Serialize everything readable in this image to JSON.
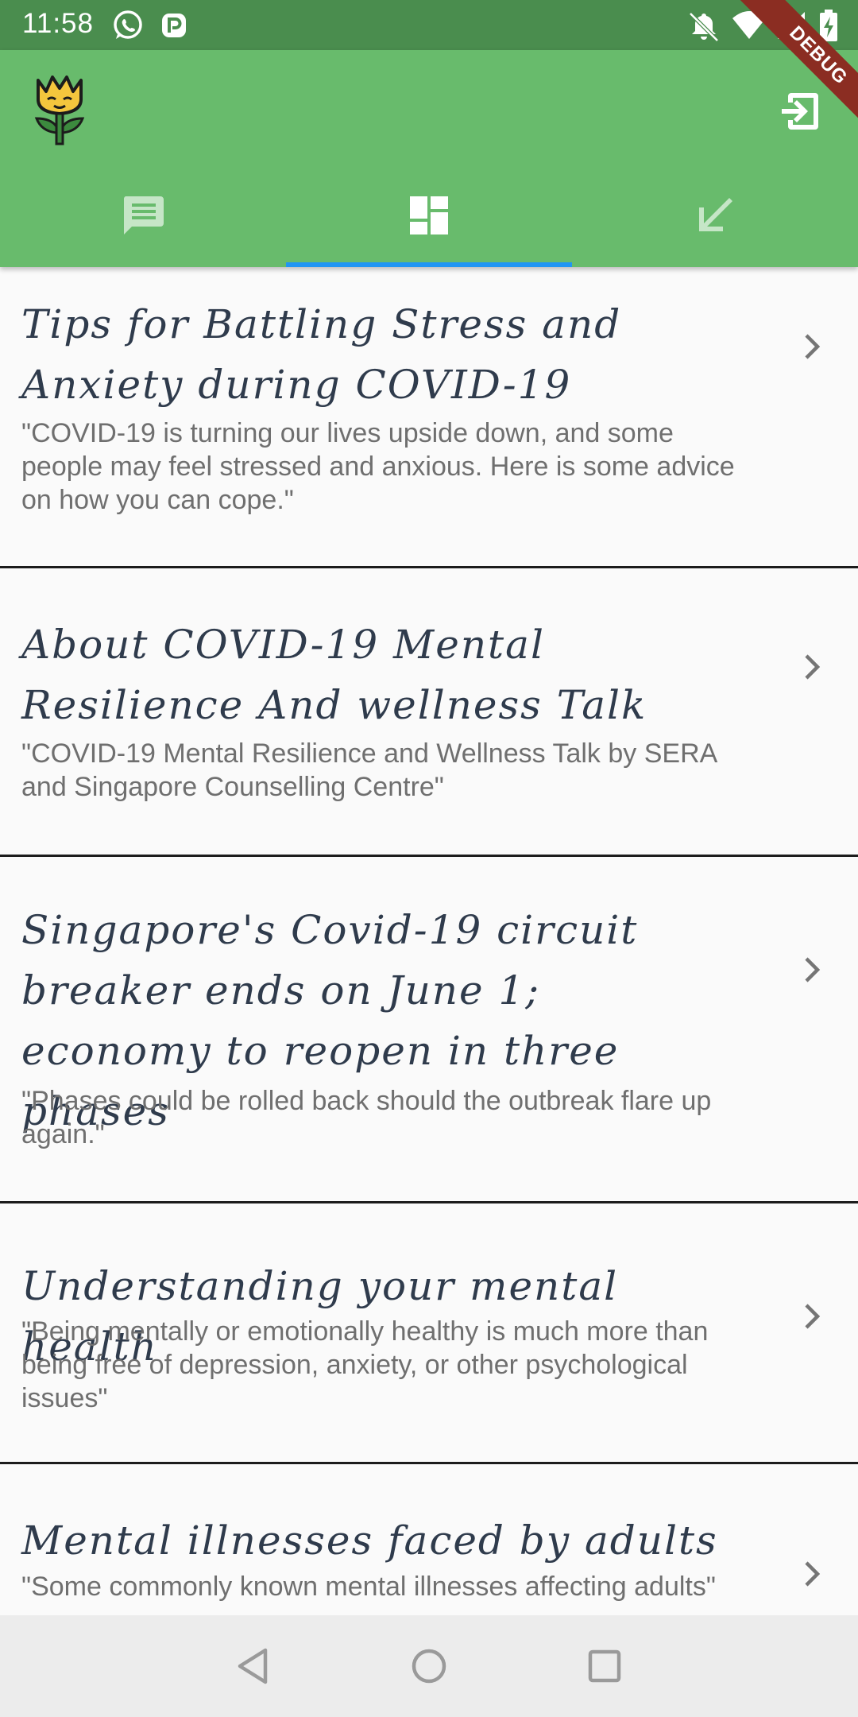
{
  "status_bar": {
    "time": "11:58",
    "left_icons": [
      "whatsapp-icon",
      "p-notification-icon"
    ],
    "right_icons": [
      "bell-off-icon",
      "wifi-icon",
      "cell-signal-icon",
      "battery-charging-icon"
    ],
    "bg_color": "#4a8d4e"
  },
  "app_bar": {
    "bg_color": "#68bb6c",
    "logo_icon": "tulip-logo-icon",
    "action_icon": "exit-icon",
    "tabs": [
      {
        "icon": "chat-icon",
        "selected": false
      },
      {
        "icon": "dashboard-icon",
        "selected": true
      },
      {
        "icon": "arrow-down-left-icon",
        "selected": false
      }
    ],
    "indicator_color": "#2196f3"
  },
  "debug_banner": "DEBUG",
  "articles": [
    {
      "title": "Tips for Battling Stress and Anxiety during COVID-19",
      "subtitle": "\"COVID-19 is turning our lives upside down, and some people may feel stressed and anxious. Here is some advice on how you can cope.\""
    },
    {
      "title": "About COVID-19 Mental Resilience And wellness Talk",
      "subtitle": "\"COVID-19 Mental Resilience and Wellness Talk by SERA and Singapore Counselling Centre\""
    },
    {
      "title": "Singapore's Covid-19 circuit breaker ends on June 1; economy to reopen in three phases",
      "subtitle": "\"Phases could be rolled back should the outbreak flare up again.\""
    },
    {
      "title": "Understanding your mental health",
      "subtitle": "\"Being mentally or emotionally healthy is much more than being free of depression, anxiety, or other psychological issues\""
    },
    {
      "title": "Mental illnesses faced by adults",
      "subtitle": "\"Some commonly known mental illnesses affecting adults\""
    }
  ],
  "nav_bar": {
    "buttons": [
      "back-icon",
      "home-icon",
      "recents-icon"
    ]
  }
}
